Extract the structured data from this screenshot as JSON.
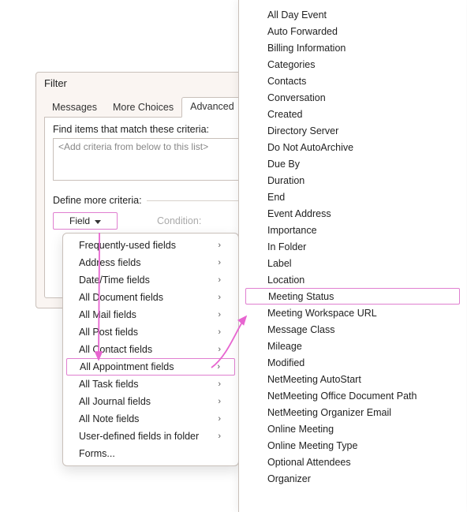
{
  "dialog": {
    "title": "Filter",
    "tabs": [
      "Messages",
      "More Choices",
      "Advanced"
    ],
    "active_tab": 2,
    "criteria_label": "Find items that match these criteria:",
    "criteria_placeholder": "<Add criteria from below to this list>",
    "define_label": "Define more criteria:",
    "field_button": "Field",
    "condition_label": "Condition:"
  },
  "fields_menu": {
    "items": [
      "Frequently-used fields",
      "Address fields",
      "Date/Time fields",
      "All Document fields",
      "All Mail fields",
      "All Post fields",
      "All Contact fields",
      "All Appointment fields",
      "All Task fields",
      "All Journal fields",
      "All Note fields",
      "User-defined fields in folder"
    ],
    "forms": "Forms...",
    "highlight_index": 7
  },
  "submenu": {
    "items": [
      "All Day Event",
      "Auto Forwarded",
      "Billing Information",
      "Categories",
      "Contacts",
      "Conversation",
      "Created",
      "Directory Server",
      "Do Not AutoArchive",
      "Due By",
      "Duration",
      "End",
      "Event Address",
      "Importance",
      "In Folder",
      "Label",
      "Location",
      "Meeting Status",
      "Meeting Workspace URL",
      "Message Class",
      "Mileage",
      "Modified",
      "NetMeeting AutoStart",
      "NetMeeting Office Document Path",
      "NetMeeting Organizer Email",
      "Online Meeting",
      "Online Meeting Type",
      "Optional Attendees",
      "Organizer"
    ],
    "highlight_index": 17
  }
}
